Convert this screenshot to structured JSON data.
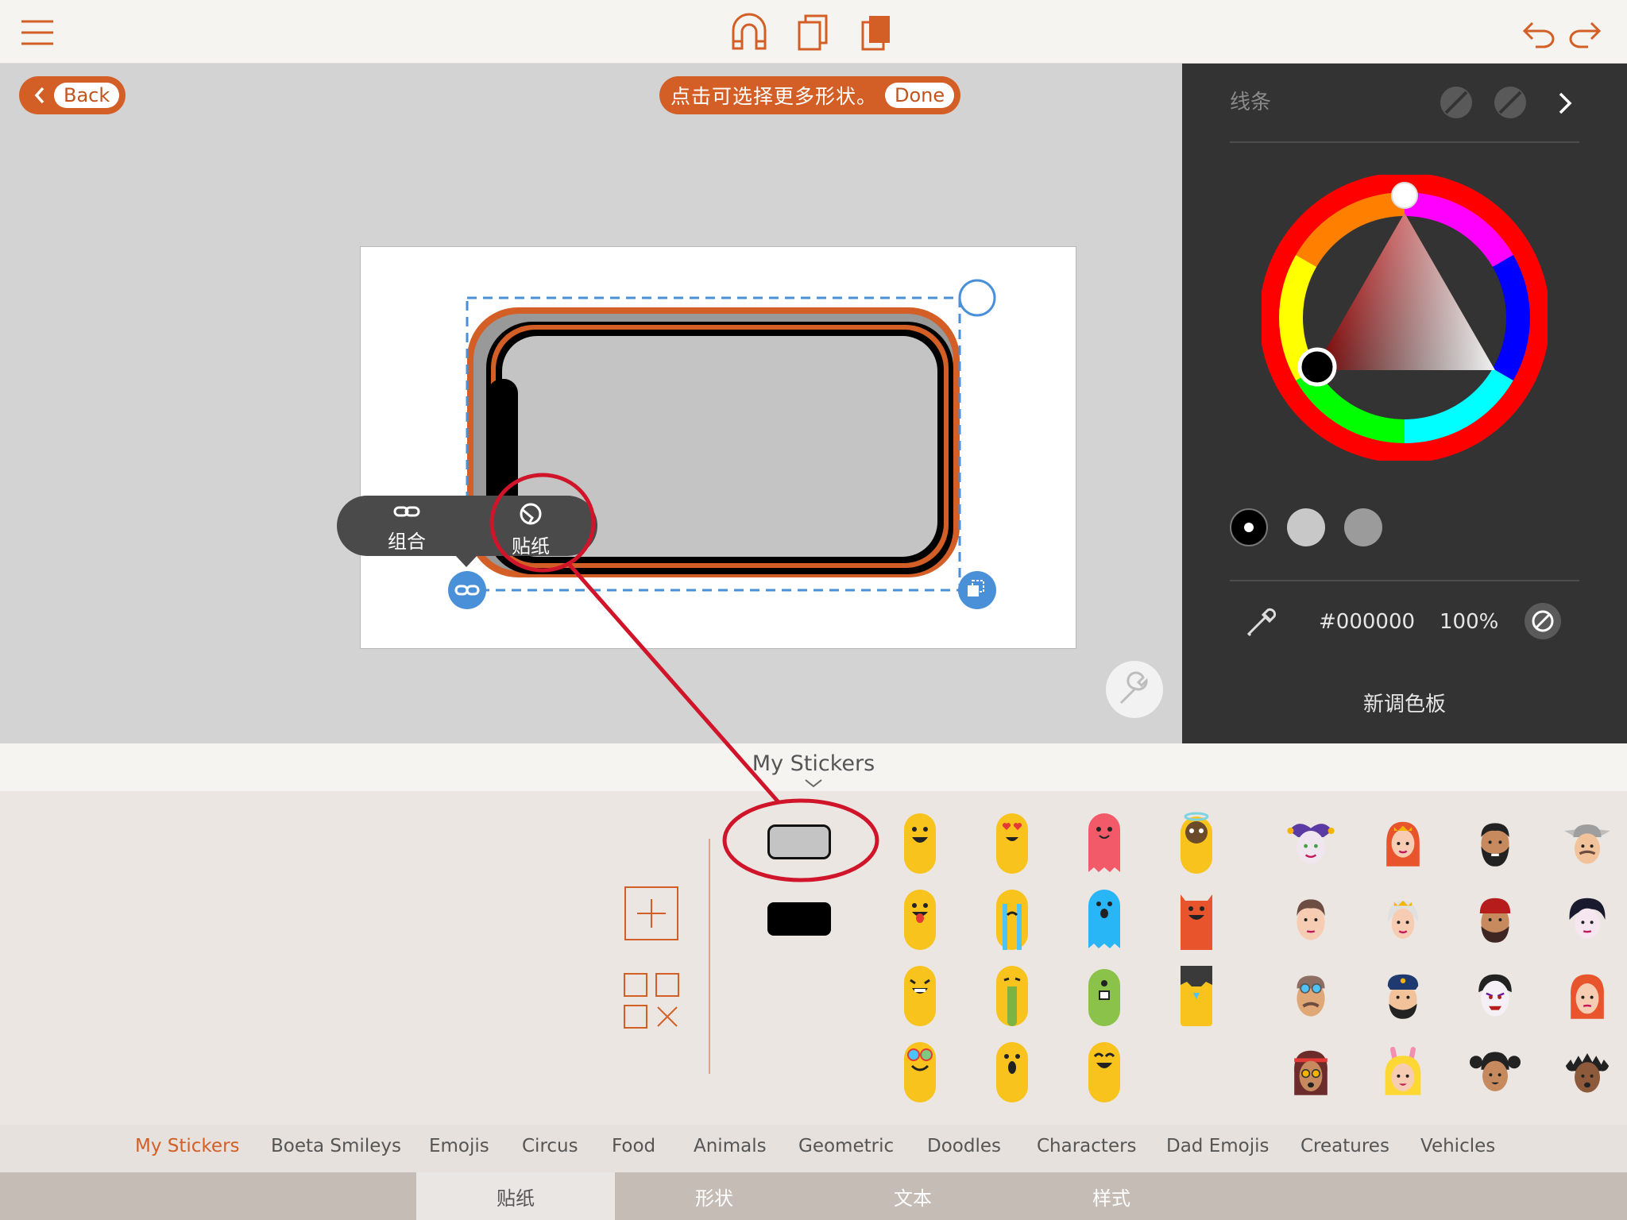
{
  "toolbar": {
    "icons": [
      "menu-icon",
      "magnet-icon",
      "duplicate-icon",
      "paste-icon",
      "undo-icon",
      "redo-icon"
    ]
  },
  "canvas": {
    "back_label": "Back",
    "hint_text": "点击可选择更多形状。",
    "done_label": "Done",
    "context_menu": {
      "group_label": "组合",
      "sticker_label": "贴纸"
    }
  },
  "panel": {
    "stroke_label": "线条",
    "hex_value": "#000000",
    "opacity_value": "100%",
    "new_palette_label": "新调色板",
    "swatches": [
      "#000000",
      "#c8c8c8",
      "#9b9b9b"
    ]
  },
  "stickers": {
    "header_title": "My Stickers",
    "categories": [
      "My Stickers",
      "Boeta Smileys",
      "Emojis",
      "Circus",
      "Food",
      "Animals",
      "Geometric",
      "Doodles",
      "Characters",
      "Dad Emojis",
      "Creatures",
      "Vehicles"
    ]
  },
  "tabs": [
    "贴纸",
    "形状",
    "文本",
    "样式"
  ],
  "colors": {
    "accent": "#d35f26",
    "selection": "#4a90d9",
    "annotation": "#d0142a"
  }
}
